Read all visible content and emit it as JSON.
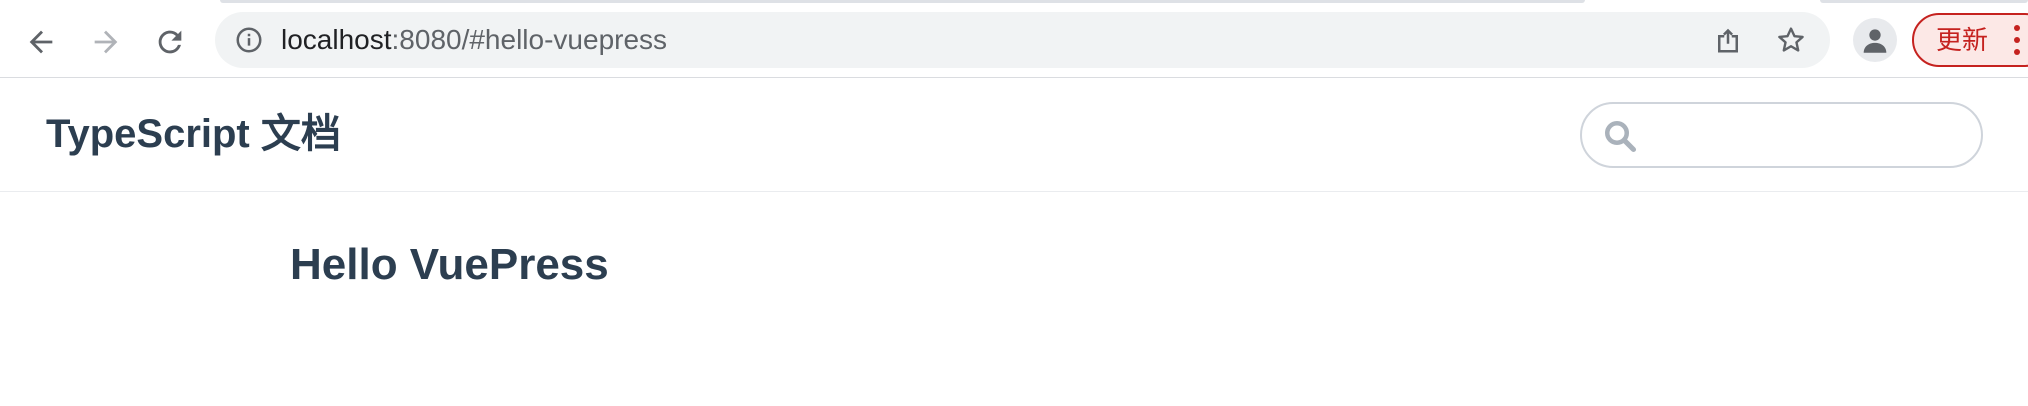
{
  "browser": {
    "url_host": "localhost",
    "url_rest": ":8080/#hello-vuepress",
    "update_label": "更新",
    "icons": {
      "back": "arrow-left-icon",
      "forward": "arrow-right-icon",
      "reload": "reload-icon",
      "info": "info-icon",
      "share": "share-icon",
      "bookmark": "star-icon",
      "profile": "person-icon",
      "menu": "kebab-menu-icon"
    }
  },
  "site": {
    "title": "TypeScript 文档",
    "search": {
      "placeholder": "",
      "value": ""
    }
  },
  "content": {
    "heading": "Hello VuePress"
  },
  "colors": {
    "text": "#2c3e50",
    "update_red": "#c5221f",
    "omnibox_bg": "#f1f3f4"
  }
}
